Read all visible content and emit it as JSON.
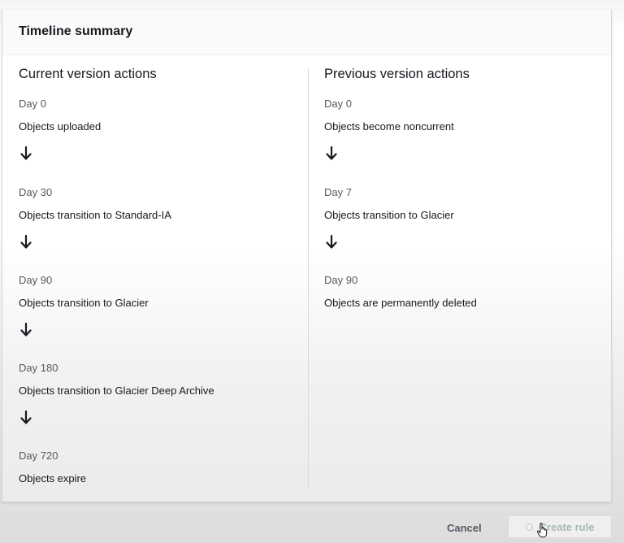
{
  "panel": {
    "title": "Timeline summary"
  },
  "current": {
    "title": "Current version actions",
    "steps": [
      {
        "day": "Day 0",
        "action": "Objects uploaded"
      },
      {
        "day": "Day 30",
        "action": "Objects transition to Standard-IA"
      },
      {
        "day": "Day 90",
        "action": "Objects transition to Glacier"
      },
      {
        "day": "Day 180",
        "action": "Objects transition to Glacier Deep Archive"
      },
      {
        "day": "Day 720",
        "action": "Objects expire"
      }
    ]
  },
  "previous": {
    "title": "Previous version actions",
    "steps": [
      {
        "day": "Day 0",
        "action": "Objects become noncurrent"
      },
      {
        "day": "Day 7",
        "action": "Objects transition to Glacier"
      },
      {
        "day": "Day 90",
        "action": "Objects are permanently deleted"
      }
    ]
  },
  "footer": {
    "cancel_label": "Cancel",
    "create_label": "Create rule"
  },
  "icons": {
    "arrow": "arrow-down-icon",
    "spinner": "spinner-icon",
    "cursor": "hand-cursor-icon"
  }
}
